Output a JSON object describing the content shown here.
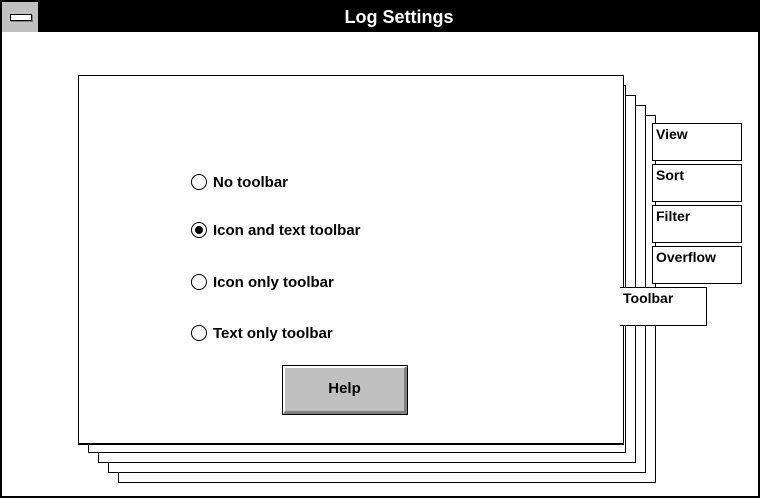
{
  "window": {
    "title": "Log Settings"
  },
  "page": {
    "options": [
      {
        "label": "No toolbar",
        "selected": false
      },
      {
        "label": "Icon and text toolbar",
        "selected": true
      },
      {
        "label": "Icon only toolbar",
        "selected": false
      },
      {
        "label": "Text only toolbar",
        "selected": false
      }
    ],
    "help_label": "Help"
  },
  "tabs": [
    "View",
    "Sort",
    "Filter",
    "Overflow",
    "Toolbar"
  ],
  "active_tab": "Toolbar"
}
